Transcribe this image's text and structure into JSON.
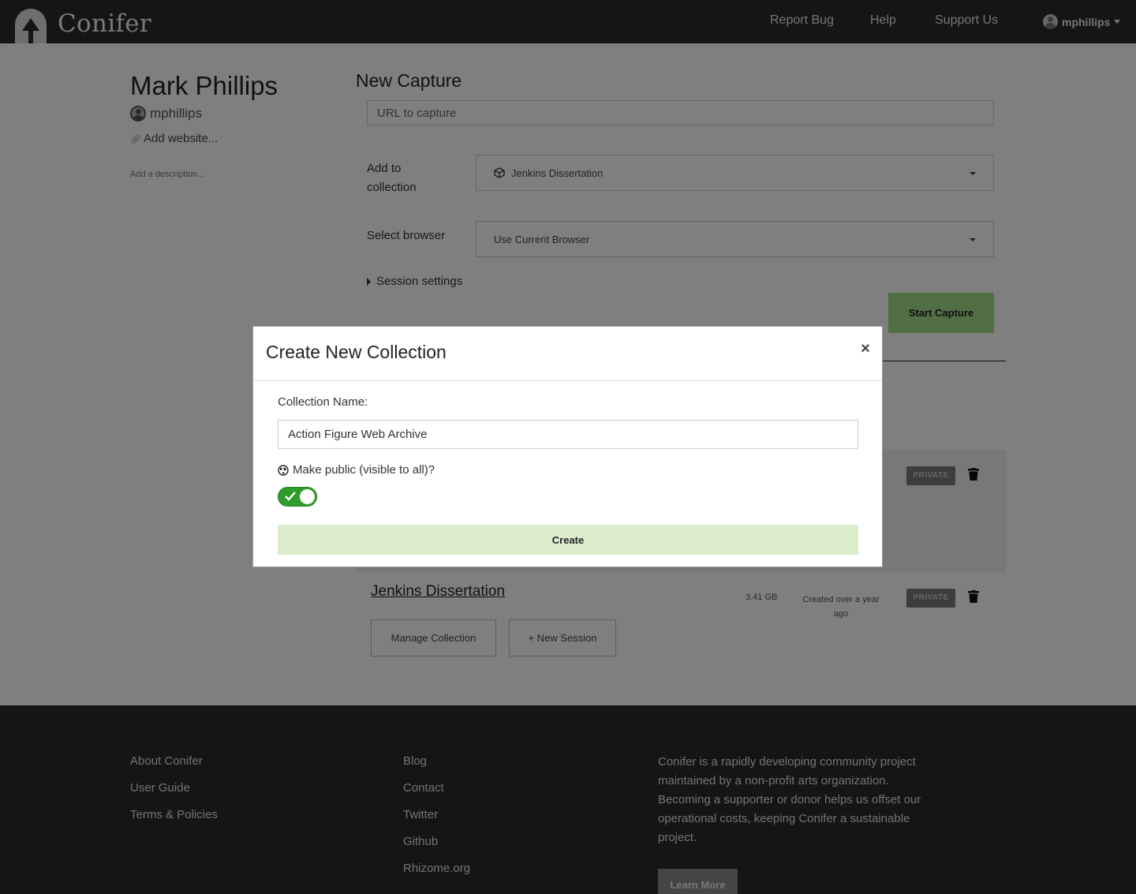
{
  "header": {
    "brand": "Conifer",
    "nav": {
      "report_bug": "Report Bug",
      "help": "Help",
      "support_us": "Support Us"
    },
    "user": "mphillips"
  },
  "profile": {
    "name": "Mark Phillips",
    "username": "mphillips",
    "add_website": "Add website...",
    "add_description": "Add a description..."
  },
  "capture": {
    "title": "New Capture",
    "url_placeholder": "URL to capture",
    "add_to_label_line1": "Add to",
    "add_to_label_line2": "collection",
    "collection_value": "Jenkins Dissertation",
    "browser_label": "Select browser",
    "browser_value": "Use Current Browser",
    "session_settings": "Session settings",
    "start_button": "Start Capture"
  },
  "collections": [
    {
      "visibility": "PRIVATE"
    },
    {
      "title": "Jenkins Dissertation",
      "size": "3.41 GB",
      "created_line1": "Created over a year",
      "created_line2": "ago",
      "visibility": "PRIVATE",
      "manage_button": "Manage Collection",
      "new_session_button": "+ New Session"
    }
  ],
  "footer": {
    "col1": [
      "About Conifer",
      "User Guide",
      "Terms & Policies"
    ],
    "col2": [
      "Blog",
      "Contact",
      "Twitter",
      "Github",
      "Rhizome.org"
    ],
    "blurb": "Conifer is a rapidly developing community project maintained by a non-profit arts organization. Becoming a supporter or donor helps us offset our operational costs, keeping Conifer a sustainable project.",
    "learn_more": "Learn More"
  },
  "modal": {
    "title": "Create New Collection",
    "close": "×",
    "name_label": "Collection Name:",
    "name_value": "Action Figure Web Archive",
    "public_label": "Make public (visible to all)?",
    "public_enabled": true,
    "create_button": "Create"
  },
  "colors": {
    "header_bg": "#2b2b2b",
    "start_capture": "#a2dc8a",
    "toggle_on": "#2e9c2a",
    "create_button": "#dcedcc"
  },
  "icons": [
    "conifer-logo-icon",
    "user-avatar-icon",
    "link-icon",
    "cube-icon",
    "chevron-down-icon",
    "triangle-right-icon",
    "trash-icon",
    "globe-icon",
    "check-icon",
    "close-icon",
    "plus-icon"
  ]
}
